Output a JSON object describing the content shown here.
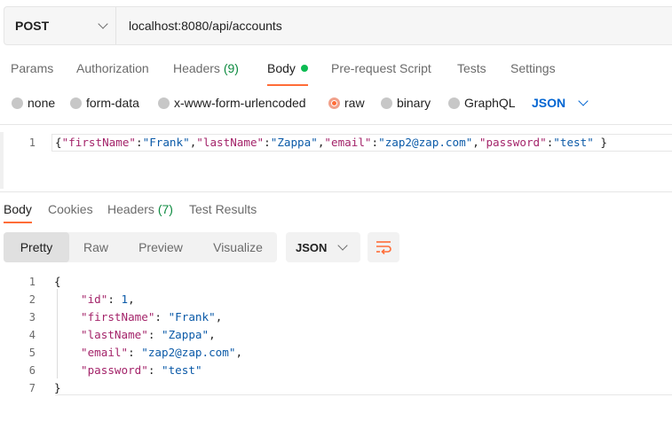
{
  "request": {
    "method": "POST",
    "url": "localhost:8080/api/accounts"
  },
  "request_tabs": [
    {
      "label": "Params"
    },
    {
      "label": "Authorization"
    },
    {
      "label": "Headers",
      "count": "(9)"
    },
    {
      "label": "Body"
    },
    {
      "label": "Pre-request Script"
    },
    {
      "label": "Tests"
    },
    {
      "label": "Settings"
    }
  ],
  "body_types": [
    {
      "label": "none"
    },
    {
      "label": "form-data"
    },
    {
      "label": "x-www-form-urlencoded"
    },
    {
      "label": "raw"
    },
    {
      "label": "binary"
    },
    {
      "label": "GraphQL"
    }
  ],
  "body_format": "JSON",
  "request_body": {
    "line_number": "1",
    "fields": {
      "firstName": "Frank",
      "lastName": "Zappa",
      "email": "zap2@zap.com",
      "password": "test"
    }
  },
  "response_tabs": [
    {
      "label": "Body"
    },
    {
      "label": "Cookies"
    },
    {
      "label": "Headers",
      "count": "(7)"
    },
    {
      "label": "Test Results"
    }
  ],
  "view_modes": [
    "Pretty",
    "Raw",
    "Preview",
    "Visualize"
  ],
  "response_format": "JSON",
  "response_body": {
    "line_numbers": [
      "1",
      "2",
      "3",
      "4",
      "5",
      "6",
      "7"
    ],
    "open_brace": "{",
    "close_brace": "}",
    "id": "1",
    "firstName": "Frank",
    "lastName": "Zappa",
    "email": "zap2@zap.com",
    "password": "test"
  },
  "colors": {
    "accent": "#ff6c37",
    "count_green": "#0c8a3f",
    "json_blue": "#0265d2"
  },
  "icons": [
    "chevron-down-icon",
    "wrap-lines-icon",
    "status-dot-icon"
  ]
}
